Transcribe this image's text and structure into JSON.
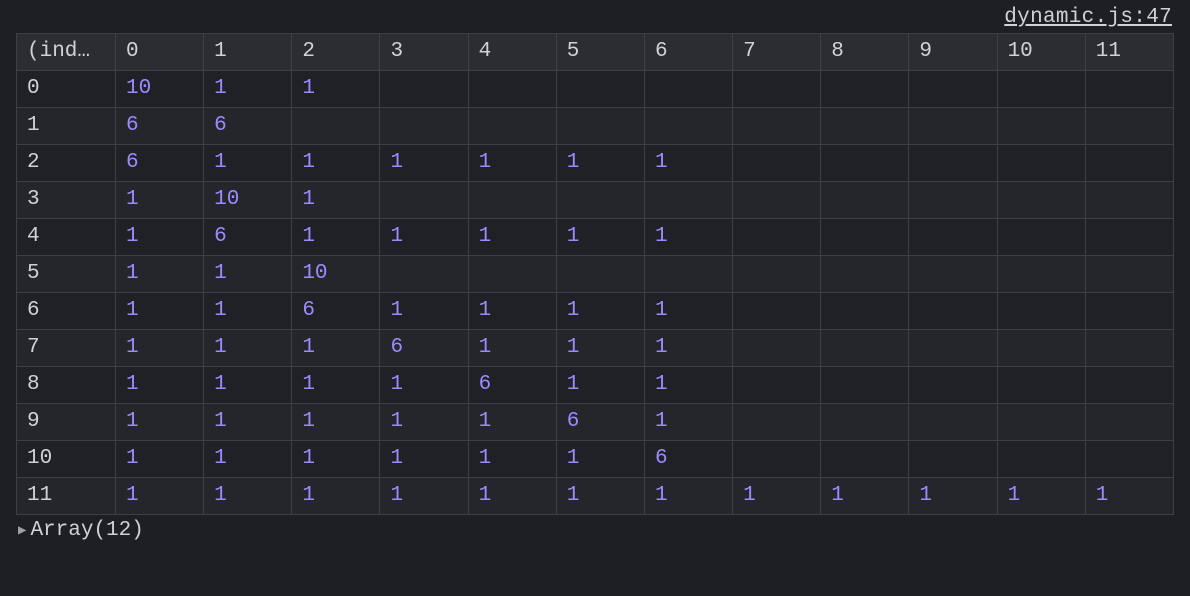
{
  "source_link": "dynamic.js:47",
  "index_header": "(ind…",
  "column_headers": [
    "0",
    "1",
    "2",
    "3",
    "4",
    "5",
    "6",
    "7",
    "8",
    "9",
    "10",
    "11"
  ],
  "row_indices": [
    "0",
    "1",
    "2",
    "3",
    "4",
    "5",
    "6",
    "7",
    "8",
    "9",
    "10",
    "11"
  ],
  "rows": [
    [
      "10",
      "1",
      "1",
      "",
      "",
      "",
      "",
      "",
      "",
      "",
      "",
      ""
    ],
    [
      "6",
      "6",
      "",
      "",
      "",
      "",
      "",
      "",
      "",
      "",
      "",
      ""
    ],
    [
      "6",
      "1",
      "1",
      "1",
      "1",
      "1",
      "1",
      "",
      "",
      "",
      "",
      ""
    ],
    [
      "1",
      "10",
      "1",
      "",
      "",
      "",
      "",
      "",
      "",
      "",
      "",
      ""
    ],
    [
      "1",
      "6",
      "1",
      "1",
      "1",
      "1",
      "1",
      "",
      "",
      "",
      "",
      ""
    ],
    [
      "1",
      "1",
      "10",
      "",
      "",
      "",
      "",
      "",
      "",
      "",
      "",
      ""
    ],
    [
      "1",
      "1",
      "6",
      "1",
      "1",
      "1",
      "1",
      "",
      "",
      "",
      "",
      ""
    ],
    [
      "1",
      "1",
      "1",
      "6",
      "1",
      "1",
      "1",
      "",
      "",
      "",
      "",
      ""
    ],
    [
      "1",
      "1",
      "1",
      "1",
      "6",
      "1",
      "1",
      "",
      "",
      "",
      "",
      ""
    ],
    [
      "1",
      "1",
      "1",
      "1",
      "1",
      "6",
      "1",
      "",
      "",
      "",
      "",
      ""
    ],
    [
      "1",
      "1",
      "1",
      "1",
      "1",
      "1",
      "6",
      "",
      "",
      "",
      "",
      ""
    ],
    [
      "1",
      "1",
      "1",
      "1",
      "1",
      "1",
      "1",
      "1",
      "1",
      "1",
      "1",
      "1"
    ]
  ],
  "footer_label": "Array(12)"
}
